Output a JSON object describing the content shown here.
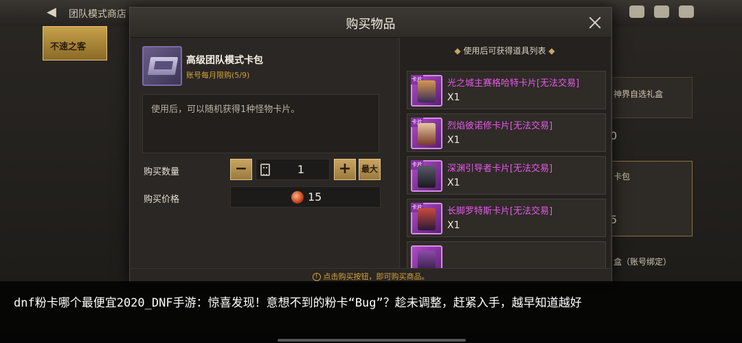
{
  "background": {
    "title": "团队模式商店",
    "tab_label": "不速之客",
    "right_card_1": "神界自选礼盒",
    "right_card_2": "卡包",
    "right_card_3": "盒（账号绑定）",
    "right_num_1": "0",
    "right_num_2": "5"
  },
  "dialog": {
    "title": "购买物品",
    "item": {
      "name": "高级团队模式卡包",
      "limit": "账号每月限购(5/9)",
      "description": "使用后，可以随机获得1种怪物卡片。"
    },
    "quantity_label": "购买数量",
    "quantity_value": "1",
    "max_label": "最大",
    "price_label": "购买价格",
    "price_value": "15",
    "rewards_title": "使用后可获得道具列表",
    "rewards": [
      {
        "name": "光之城主赛格哈特卡片[无法交易]",
        "qty": "X1",
        "badge": "卡片"
      },
      {
        "name": "烈焰彼诺修卡片[无法交易]",
        "qty": "X1",
        "badge": "卡片"
      },
      {
        "name": "深渊引导者卡片[无法交易]",
        "qty": "X1",
        "badge": "卡片"
      },
      {
        "name": "长脚罗特斯卡片[无法交易]",
        "qty": "X1",
        "badge": "卡片"
      }
    ],
    "footer_hint": "点击购买按钮，即可购买商品。"
  },
  "caption": {
    "text": "dnf粉卡哪个最便宜2020_DNF手游：惊喜发现！意想不到的粉卡“Bug”？趁未调整，赶紧入手，越早知道越好"
  },
  "colors": {
    "accent_gold": "#c9a562",
    "rare_pink": "#e45ae8",
    "limit_orange": "#d2a13a"
  }
}
